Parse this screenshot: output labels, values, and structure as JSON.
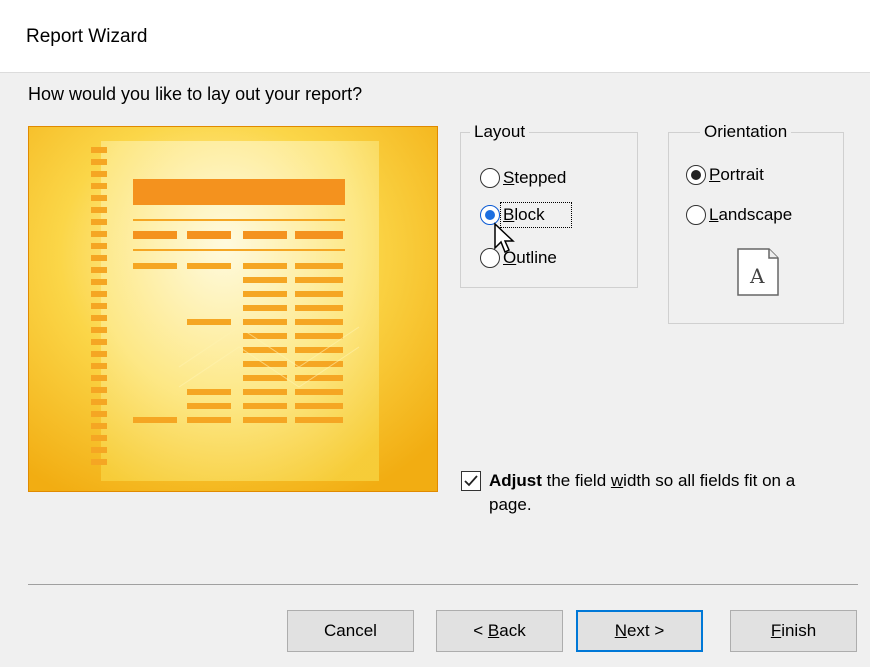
{
  "window": {
    "title": "Report Wizard"
  },
  "question": "How would you like to lay out your report?",
  "layout": {
    "legend": "Layout",
    "options": [
      {
        "pre": "",
        "ul": "S",
        "post": "tepped",
        "checked": false
      },
      {
        "pre": "",
        "ul": "B",
        "post": "lock",
        "checked": true
      },
      {
        "pre": "",
        "ul": "O",
        "post": "utline",
        "checked": false
      }
    ]
  },
  "orientation": {
    "legend": "Orientation",
    "options": [
      {
        "pre": "",
        "ul": "P",
        "post": "ortrait",
        "checked": true
      },
      {
        "pre": "",
        "ul": "L",
        "post": "andscape",
        "checked": false
      }
    ],
    "page_icon_letter": "A"
  },
  "adjust": {
    "checked": true,
    "bold": "Adjust",
    "text_a": " the field ",
    "ul": "w",
    "text_b": "idth so all fields fit on a page."
  },
  "buttons": {
    "cancel": "Cancel",
    "back_pre": "< ",
    "back_ul": "B",
    "back_post": "ack",
    "next_ul": "N",
    "next_post": "ext >",
    "finish_ul": "F",
    "finish_post": "inish"
  },
  "colors": {
    "preview_bg": "#f7c10e",
    "preview_border": "#e08a00",
    "accent_orange": "#f5a623",
    "primary_button_border": "#0078d7"
  }
}
